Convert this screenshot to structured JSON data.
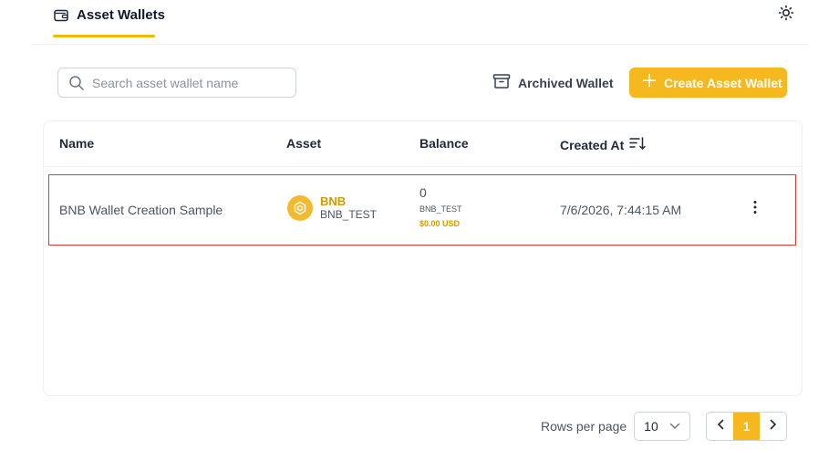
{
  "header": {
    "tab_label": "Asset Wallets"
  },
  "toolbar": {
    "search_placeholder": "Search asset wallet name",
    "archived_label": "Archived Wallet",
    "create_label": "Create Asset Wallet"
  },
  "table": {
    "columns": [
      "Name",
      "Asset",
      "Balance",
      "Created At"
    ],
    "rows": [
      {
        "name": "BNB Wallet Creation Sample",
        "asset_symbol": "BNB",
        "asset_network": "BNB_TEST",
        "balance_amount": "0",
        "balance_network": "BNB_TEST",
        "balance_usd": "$0.00 USD",
        "created_at": "7/6/2026, 7:44:15 AM"
      }
    ]
  },
  "pagination": {
    "rows_per_page_label": "Rows per page",
    "rows_per_page_value": "10",
    "current_page": "1"
  },
  "colors": {
    "accent": "#f5b91f",
    "highlight_border": "#e53935",
    "asset_text": "#d49a00"
  }
}
